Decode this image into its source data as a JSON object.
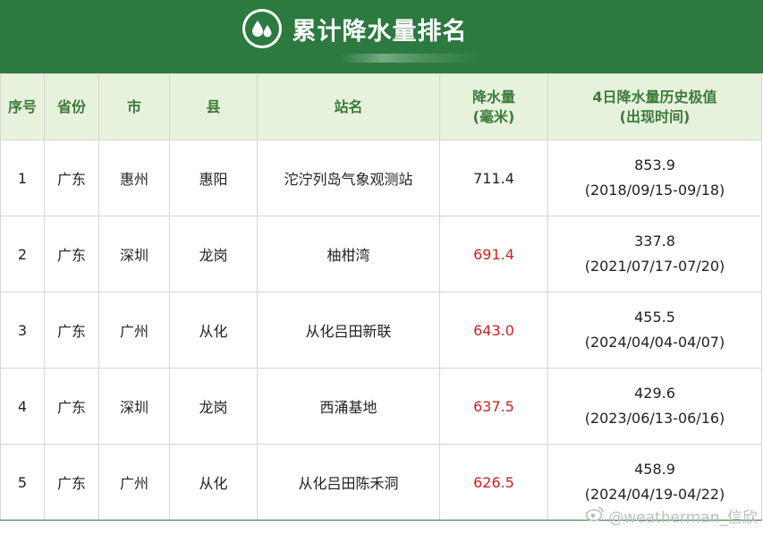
{
  "banner": {
    "title": "累计降水量排名",
    "logo_icon": "water-drops-icon",
    "bg_color": "#2c7a3f"
  },
  "table": {
    "headers": {
      "rank": "序号",
      "province": "省份",
      "city": "市",
      "county": "县",
      "station": "站名",
      "rain_line1": "降水量",
      "rain_line2": "(毫米)",
      "record_line1": "4日降水量历史极值",
      "record_line2": "(出现时间)"
    },
    "rows": [
      {
        "rank": "1",
        "province": "广东",
        "city": "惠州",
        "county": "惠阳",
        "station": "沱泞列岛气象观测站",
        "rain": "711.4",
        "rain_color": "#222222",
        "record_value": "853.9",
        "record_date": "(2018/09/15-09/18)"
      },
      {
        "rank": "2",
        "province": "广东",
        "city": "深圳",
        "county": "龙岗",
        "station": "柚柑湾",
        "rain": "691.4",
        "rain_color": "#d11f1f",
        "record_value": "337.8",
        "record_date": "(2021/07/17-07/20)"
      },
      {
        "rank": "3",
        "province": "广东",
        "city": "广州",
        "county": "从化",
        "station": "从化吕田新联",
        "rain": "643.0",
        "rain_color": "#d11f1f",
        "record_value": "455.5",
        "record_date": "(2024/04/04-04/07)"
      },
      {
        "rank": "4",
        "province": "广东",
        "city": "深圳",
        "county": "龙岗",
        "station": "西涌基地",
        "rain": "637.5",
        "rain_color": "#d11f1f",
        "record_value": "429.6",
        "record_date": "(2023/06/13-06/16)"
      },
      {
        "rank": "5",
        "province": "广东",
        "city": "广州",
        "county": "从化",
        "station": "从化吕田陈禾洞",
        "rain": "626.5",
        "rain_color": "#d11f1f",
        "record_value": "458.9",
        "record_date": "(2024/04/19-04/22)"
      }
    ]
  },
  "watermark": {
    "text": "@weatherman_信欣",
    "icon": "weibo-icon"
  }
}
